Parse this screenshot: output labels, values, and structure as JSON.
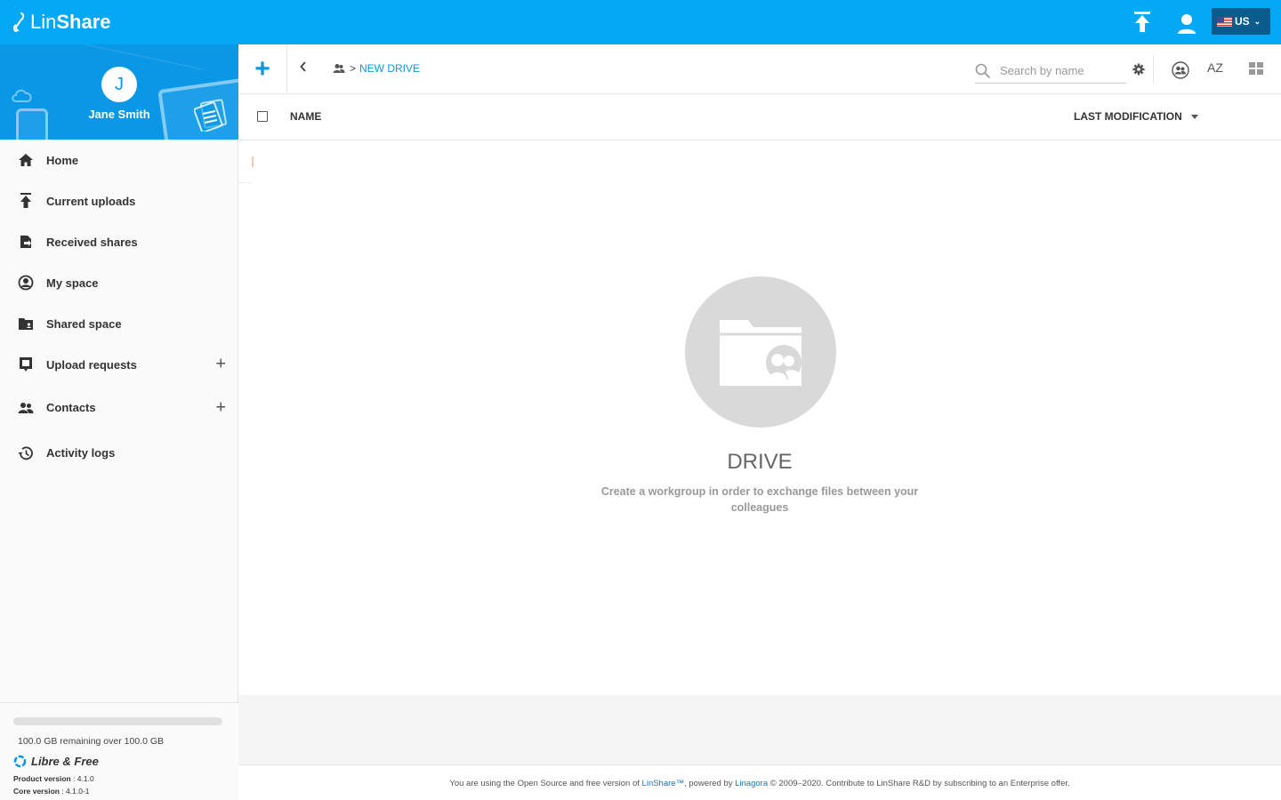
{
  "app": {
    "logo_lin": "Lin",
    "logo_share": "Share",
    "language": "US"
  },
  "profile": {
    "initial": "J",
    "name": "Jane Smith"
  },
  "nav": {
    "items": [
      {
        "label": "Home"
      },
      {
        "label": "Current uploads"
      },
      {
        "label": "Received shares"
      },
      {
        "label": "My space"
      },
      {
        "label": "Shared space"
      },
      {
        "label": "Upload requests",
        "plus": "+"
      },
      {
        "label": "Contacts",
        "plus": "+"
      },
      {
        "label": "Activity logs"
      }
    ]
  },
  "quota": {
    "text": "100.0 GB remaining over 100.0 GB",
    "used_fraction": 0.0
  },
  "edition": {
    "label": "Libre & Free",
    "product_label": "Product version",
    "product_value": " : 4.1.0",
    "core_label": "Core version",
    "core_value": " : 4.1.0-1"
  },
  "toolbar": {
    "add_label": "+",
    "back_label": "<",
    "breadcrumb_sep": ">",
    "breadcrumb_current": "NEW DRIVE",
    "search_placeholder": "Search by name",
    "sort_label": "AZ"
  },
  "table": {
    "col_name": "NAME",
    "col_modified": "LAST MODIFICATION"
  },
  "empty_state": {
    "title": "DRIVE",
    "description": "Create a workgroup in order to exchange files between your colleagues"
  },
  "footer": {
    "part1": "You are using the Open Source and free version of ",
    "link1": "LinShare™",
    "part2": ", powered by ",
    "link2": "Linagora",
    "part3": " © 2009–2020. Contribute to LinShare R&D by subscribing to an Enterprise offer."
  },
  "colors": {
    "brand": "#05a8f4",
    "profile_bg": "#0a98e6",
    "accent": "#0a98e6"
  }
}
